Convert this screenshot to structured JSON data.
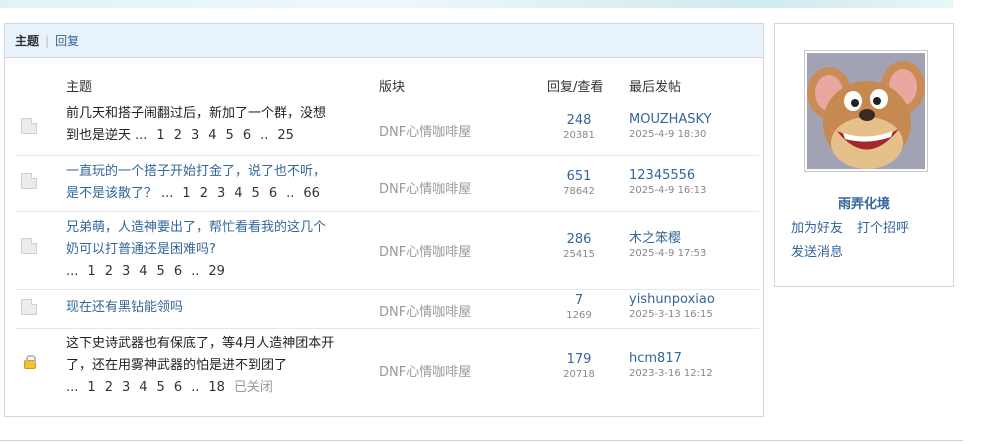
{
  "tabs": [
    {
      "label": "主题",
      "active": true
    },
    {
      "label": "回复",
      "active": false
    }
  ],
  "columns": {
    "subject": "主题",
    "forum": "版块",
    "replies_views": "回复/查看",
    "last_post": "最后发帖"
  },
  "threads": [
    {
      "icon": "document-icon",
      "title_lines": [
        "前几天和搭子闹翻过后，新加了一个群，没想",
        "到也是逆天"
      ],
      "title_link": false,
      "pages": [
        "...",
        "1",
        "2",
        "3",
        "4",
        "5",
        "6",
        "..",
        "25"
      ],
      "closed": "",
      "forum": "DNF心情咖啡屋",
      "replies": "248",
      "views": "20381",
      "last_user": "MOUZHASKY",
      "last_time": "2025-4-9 18:30"
    },
    {
      "icon": "document-icon",
      "title_lines": [
        "一直玩的一个搭子开始打金了，说了也不听，",
        "是不是该散了？"
      ],
      "title_link": true,
      "pages": [
        "...",
        "1",
        "2",
        "3",
        "4",
        "5",
        "6",
        "..",
        "66"
      ],
      "closed": "",
      "forum": "DNF心情咖啡屋",
      "replies": "651",
      "views": "78642",
      "last_user": "12345556",
      "last_time": "2025-4-9 16:13"
    },
    {
      "icon": "document-icon",
      "title_lines": [
        "兄弟萌，人造神要出了，帮忙看看我的这几个",
        "奶可以打普通还是困难吗?"
      ],
      "title_link": true,
      "pages": [
        "...",
        "1",
        "2",
        "3",
        "4",
        "5",
        "6",
        "..",
        "29"
      ],
      "closed": "",
      "forum": "DNF心情咖啡屋",
      "replies": "286",
      "views": "25415",
      "last_user": "木之笨樱",
      "last_time": "2025-4-9 17:53"
    },
    {
      "icon": "document-icon",
      "title_lines": [
        "现在还有黑钻能领吗"
      ],
      "title_link": true,
      "pages": [],
      "closed": "",
      "forum": "DNF心情咖啡屋",
      "replies": "7",
      "views": "1269",
      "last_user": "yishunpoxiao",
      "last_time": "2025-3-13 16:15"
    },
    {
      "icon": "lock-icon",
      "title_lines": [
        "这下史诗武器也有保底了，等4月人造神团本开",
        "了，还在用雾神武器的怕是进不到团了"
      ],
      "title_link": false,
      "pages": [
        "...",
        "1",
        "2",
        "3",
        "4",
        "5",
        "6",
        "..",
        "18"
      ],
      "closed": "已关闭",
      "forum": "DNF心情咖啡屋",
      "replies": "179",
      "views": "20718",
      "last_user": "hcm817",
      "last_time": "2023-3-16 12:12"
    }
  ],
  "profile": {
    "name": "雨弄化境",
    "actions": [
      "加为好友",
      "打个招呼",
      "发送消息"
    ]
  }
}
